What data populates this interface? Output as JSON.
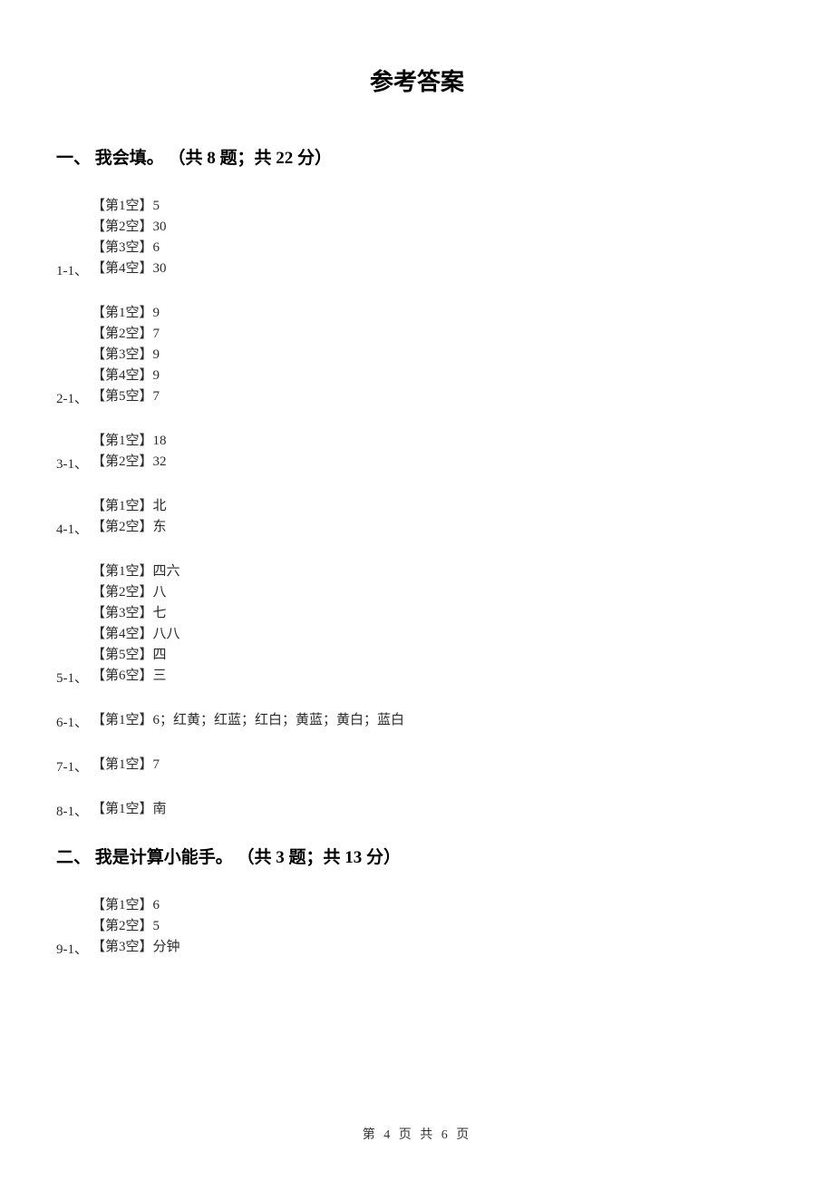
{
  "pageTitle": "参考答案",
  "sections": [
    {
      "header": "一、 我会填。 （共 8 题；共 22 分）",
      "groups": [
        {
          "label": "1-1、",
          "lines": [
            "【第1空】5",
            "【第2空】30",
            "【第3空】6",
            "【第4空】30"
          ]
        },
        {
          "label": "2-1、",
          "lines": [
            "【第1空】9",
            "【第2空】7",
            "【第3空】9",
            "【第4空】9",
            "【第5空】7"
          ]
        },
        {
          "label": "3-1、",
          "lines": [
            "【第1空】18",
            "【第2空】32"
          ]
        },
        {
          "label": "4-1、",
          "lines": [
            "【第1空】北",
            "【第2空】东"
          ]
        },
        {
          "label": "5-1、",
          "lines": [
            "【第1空】四六",
            "【第2空】八",
            "【第3空】七",
            "【第4空】八八",
            "【第5空】四",
            "【第6空】三"
          ]
        },
        {
          "label": "6-1、",
          "lines": [
            "【第1空】6；红黄；红蓝；红白；黄蓝；黄白；蓝白"
          ]
        },
        {
          "label": "7-1、",
          "lines": [
            "【第1空】7"
          ]
        },
        {
          "label": "8-1、",
          "lines": [
            "【第1空】南"
          ]
        }
      ]
    },
    {
      "header": "二、 我是计算小能手。 （共 3 题；共 13 分）",
      "groups": [
        {
          "label": "9-1、",
          "lines": [
            "【第1空】6",
            "【第2空】5",
            "【第3空】分钟"
          ]
        }
      ]
    }
  ],
  "footer": "第 4 页 共 6 页"
}
